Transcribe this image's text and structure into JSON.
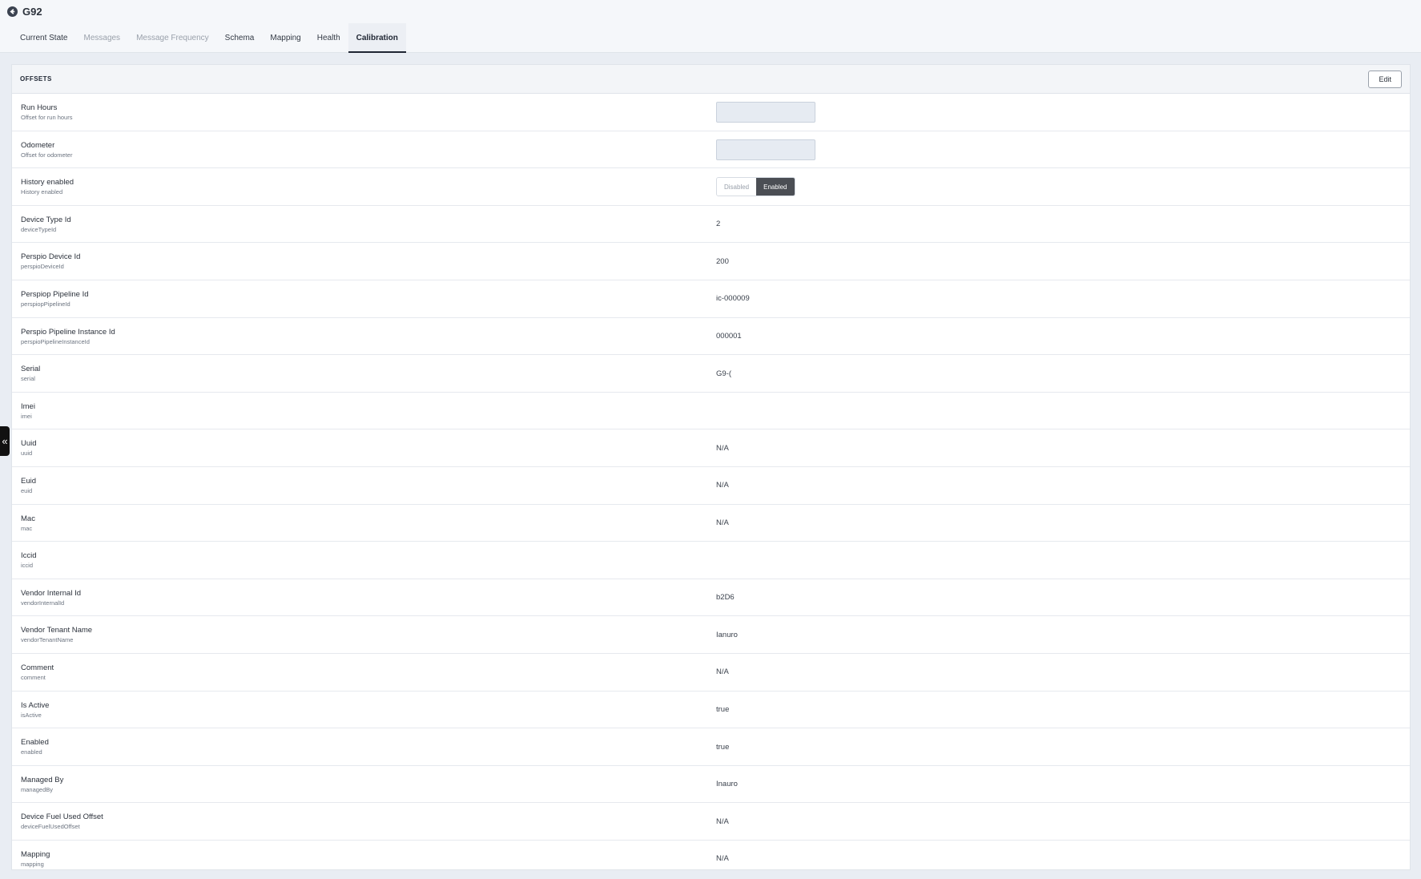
{
  "header": {
    "title": "G92",
    "tabs": [
      {
        "label": "Current State"
      },
      {
        "label": "Messages"
      },
      {
        "label": "Message Frequency"
      },
      {
        "label": "Schema"
      },
      {
        "label": "Mapping"
      },
      {
        "label": "Health"
      },
      {
        "label": "Calibration"
      }
    ]
  },
  "section": {
    "title": "OFFSETS",
    "edit_label": "Edit"
  },
  "toggle": {
    "off_label": "Disabled",
    "on_label": "Enabled",
    "selected": "Enabled"
  },
  "fields": [
    {
      "label": "Run Hours",
      "sublabel": "Offset for run hours",
      "value": ""
    },
    {
      "label": "Odometer",
      "sublabel": "Offset for odometer",
      "value": ""
    },
    {
      "label": "History enabled",
      "sublabel": "History enabled",
      "value": ""
    },
    {
      "label": "Device Type Id",
      "sublabel": "deviceTypeId",
      "value": "2"
    },
    {
      "label": "Perspio Device Id",
      "sublabel": "perspioDeviceId",
      "value": "200"
    },
    {
      "label": "Perspiop Pipeline Id",
      "sublabel": "perspiopPipelineId",
      "value": "ic-000009"
    },
    {
      "label": "Perspio Pipeline Instance Id",
      "sublabel": "perspioPipelineInstanceId",
      "value": "000001"
    },
    {
      "label": "Serial",
      "sublabel": "serial",
      "value": "G9-("
    },
    {
      "label": "Imei",
      "sublabel": "imei",
      "value": ""
    },
    {
      "label": "Uuid",
      "sublabel": "uuid",
      "value": "N/A"
    },
    {
      "label": "Euid",
      "sublabel": "euid",
      "value": "N/A"
    },
    {
      "label": "Mac",
      "sublabel": "mac",
      "value": "N/A"
    },
    {
      "label": "Iccid",
      "sublabel": "iccid",
      "value": ""
    },
    {
      "label": "Vendor Internal Id",
      "sublabel": "vendorInternalId",
      "value": "b2D6"
    },
    {
      "label": "Vendor Tenant Name",
      "sublabel": "vendorTenantName",
      "value": "Ianuro"
    },
    {
      "label": "Comment",
      "sublabel": "comment",
      "value": "N/A"
    },
    {
      "label": "Is Active",
      "sublabel": "isActive",
      "value": "true"
    },
    {
      "label": "Enabled",
      "sublabel": "enabled",
      "value": "true"
    },
    {
      "label": "Managed By",
      "sublabel": "managedBy",
      "value": "Inauro"
    },
    {
      "label": "Device Fuel Used Offset",
      "sublabel": "deviceFuelUsedOffset",
      "value": "N/A"
    },
    {
      "label": "Mapping",
      "sublabel": "mapping",
      "value": "N/A"
    }
  ],
  "side_handle": {
    "glyph": "«"
  }
}
